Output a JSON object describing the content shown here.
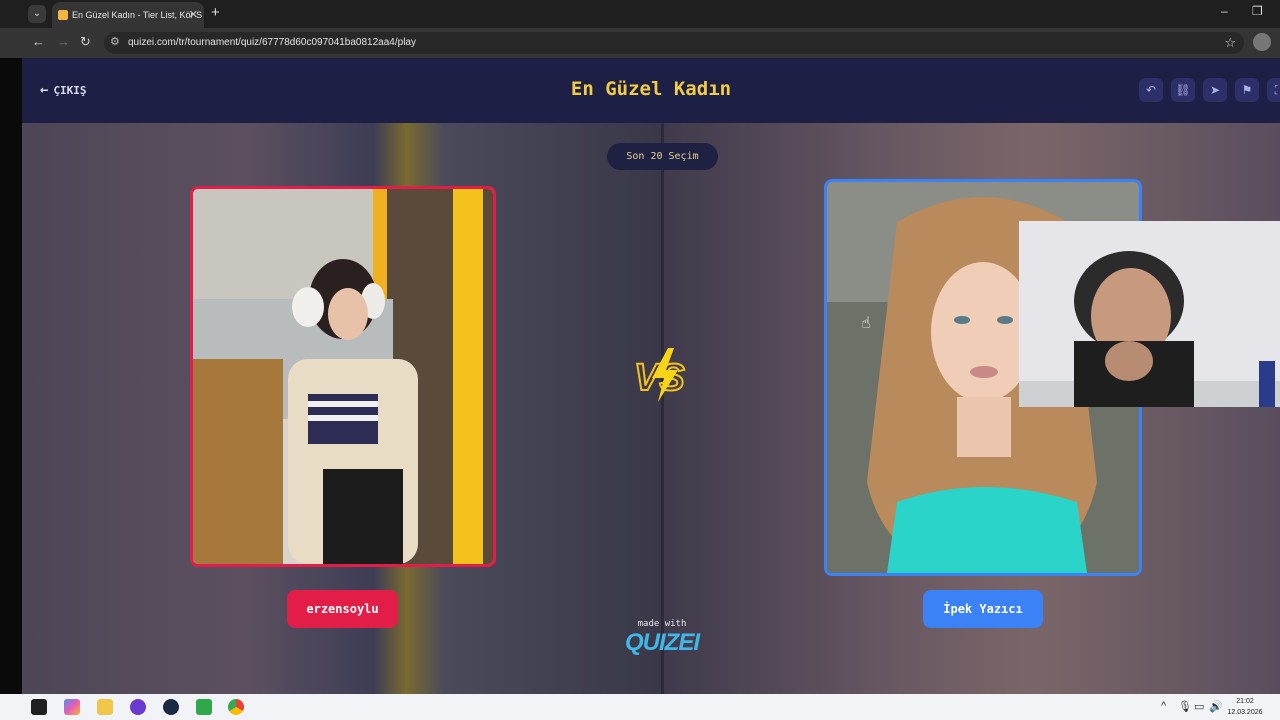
{
  "browser": {
    "tab_title": "En Güzel Kadın - Tier List, Kör S",
    "url": "quizei.com/tr/tournament/quiz/67778d60c097041ba0812aa4/play",
    "new_tab_symbol": "+",
    "tab_close_symbol": "✕",
    "minimize_symbol": "–",
    "restore_symbol": "❐"
  },
  "header": {
    "exit_label": "ÇIKIŞ",
    "title": "En Güzel Kadın",
    "buttons": [
      "undo-icon",
      "link-icon",
      "send-icon",
      "flag-icon",
      "expand-icon"
    ]
  },
  "main": {
    "round_badge": "Son 20 Seçim",
    "left_choice": {
      "name": "erzensoylu",
      "accent": "#e11d48"
    },
    "right_choice": {
      "name": "İpek Yazıcı",
      "accent": "#3b82f6"
    },
    "vs_label": "VS",
    "made_with": "made with",
    "brand": "QUIZEI"
  },
  "taskbar": {
    "time": "21:02",
    "date": "12.03.2026",
    "apps": [
      "windows-start-icon",
      "copilot-icon",
      "file-explorer-icon",
      "obs-icon",
      "steam-icon",
      "app-icon",
      "chrome-icon"
    ]
  },
  "colors": {
    "title": "#f3cc45",
    "header_bg": "#1e1f45",
    "brand": "#3fb8e8"
  }
}
